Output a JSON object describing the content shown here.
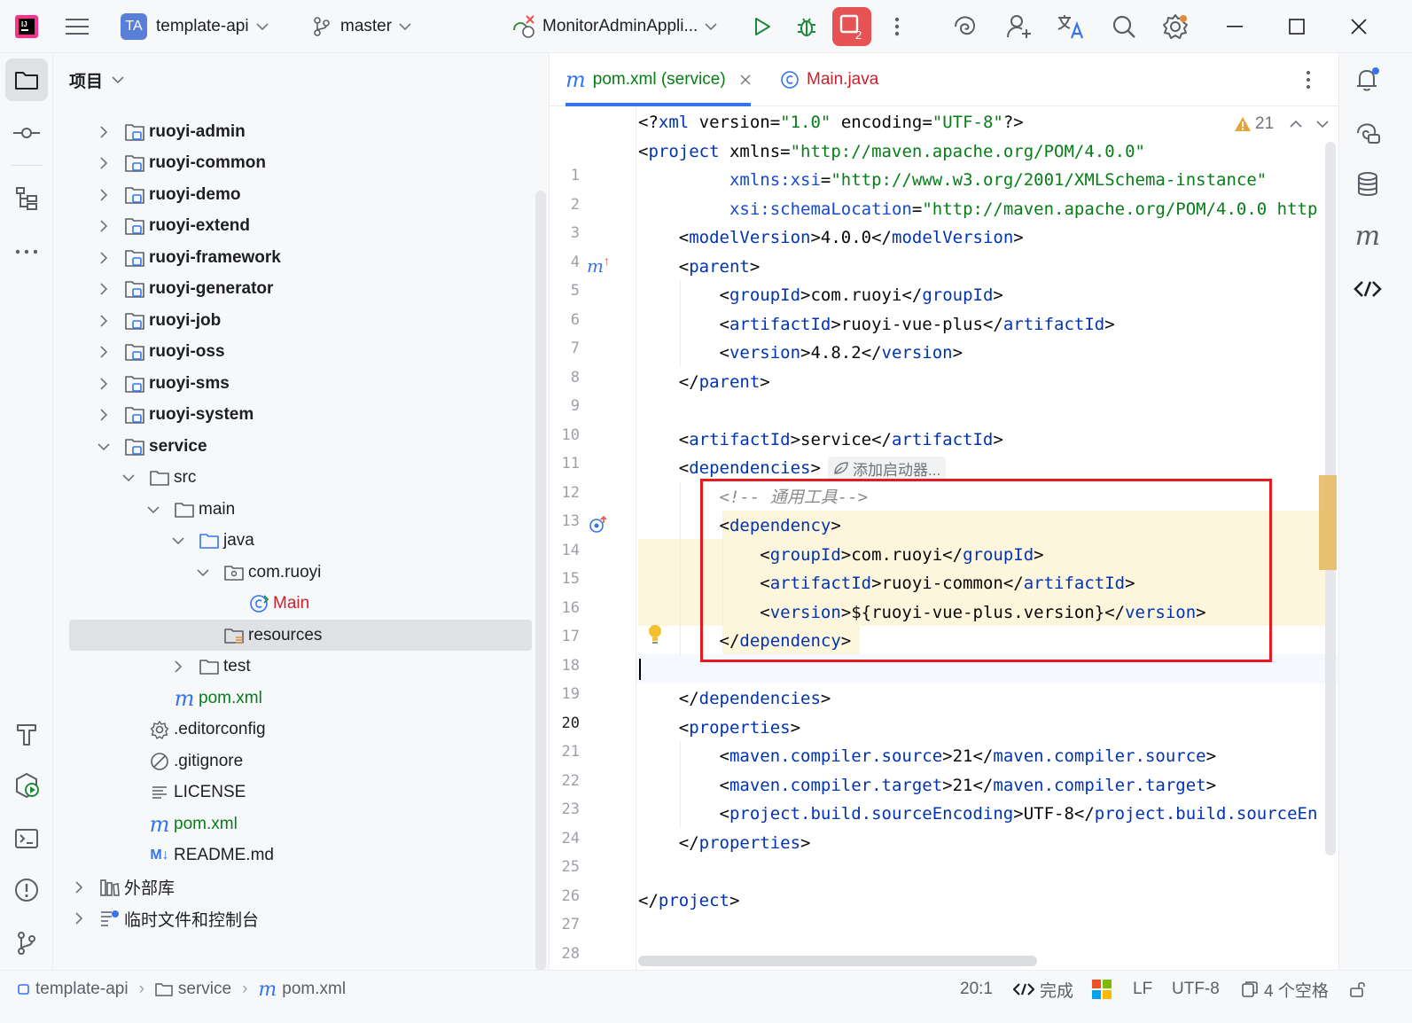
{
  "titlebar": {
    "project_badge": "TA",
    "project_name": "template-api",
    "branch": "master",
    "run_config": "MonitorAdminAppli...",
    "run_badge_count": "2",
    "icons": [
      "app-logo-icon",
      "hamburger-menu-icon",
      "branch-icon",
      "run-config-icon",
      "run-icon",
      "debug-icon",
      "more-icon",
      "ai-assistant-icon",
      "add-user-icon",
      "translate-icon",
      "search-icon",
      "settings-icon",
      "minimize-icon",
      "maximize-icon",
      "close-icon"
    ]
  },
  "project_panel": {
    "title": "项目",
    "tree": [
      {
        "label": "ruoyi-admin",
        "depth": 1,
        "kind": "module",
        "expanded": false
      },
      {
        "label": "ruoyi-common",
        "depth": 1,
        "kind": "module",
        "expanded": false
      },
      {
        "label": "ruoyi-demo",
        "depth": 1,
        "kind": "module",
        "expanded": false
      },
      {
        "label": "ruoyi-extend",
        "depth": 1,
        "kind": "module",
        "expanded": false
      },
      {
        "label": "ruoyi-framework",
        "depth": 1,
        "kind": "module",
        "expanded": false
      },
      {
        "label": "ruoyi-generator",
        "depth": 1,
        "kind": "module",
        "expanded": false
      },
      {
        "label": "ruoyi-job",
        "depth": 1,
        "kind": "module",
        "expanded": false
      },
      {
        "label": "ruoyi-oss",
        "depth": 1,
        "kind": "module",
        "expanded": false
      },
      {
        "label": "ruoyi-sms",
        "depth": 1,
        "kind": "module",
        "expanded": false
      },
      {
        "label": "ruoyi-system",
        "depth": 1,
        "kind": "module",
        "expanded": false
      },
      {
        "label": "service",
        "depth": 1,
        "kind": "module",
        "expanded": true
      },
      {
        "label": "src",
        "depth": 2,
        "kind": "folder",
        "expanded": true
      },
      {
        "label": "main",
        "depth": 3,
        "kind": "folder",
        "expanded": true
      },
      {
        "label": "java",
        "depth": 4,
        "kind": "source-folder",
        "expanded": true
      },
      {
        "label": "com.ruoyi",
        "depth": 5,
        "kind": "package",
        "expanded": true
      },
      {
        "label": "Main",
        "depth": 6,
        "kind": "class"
      },
      {
        "label": "resources",
        "depth": 5,
        "kind": "resources-folder",
        "selected": true
      },
      {
        "label": "test",
        "depth": 4,
        "kind": "folder",
        "expanded": false
      },
      {
        "label": "pom.xml",
        "depth": 3,
        "kind": "maven"
      },
      {
        "label": ".editorconfig",
        "depth": 2,
        "kind": "config"
      },
      {
        "label": ".gitignore",
        "depth": 2,
        "kind": "ignore"
      },
      {
        "label": "LICENSE",
        "depth": 2,
        "kind": "text"
      },
      {
        "label": "pom.xml",
        "depth": 2,
        "kind": "maven"
      },
      {
        "label": "README.md",
        "depth": 2,
        "kind": "markdown"
      },
      {
        "label": "外部库",
        "depth": 0,
        "kind": "library",
        "expanded": false
      },
      {
        "label": "临时文件和控制台",
        "depth": 0,
        "kind": "scratch",
        "expanded": false
      }
    ]
  },
  "editor": {
    "tabs": [
      {
        "label": "pom.xml (service)",
        "active": true,
        "icon": "maven-icon"
      },
      {
        "label": "Main.java",
        "active": false,
        "icon": "class-icon"
      }
    ],
    "warnings_count": "21",
    "inlay_hint": "添加启动器...",
    "current_line": 20,
    "lines": [
      "<?xml version=\"1.0\" encoding=\"UTF-8\"?>",
      "<project xmlns=\"http://maven.apache.org/POM/4.0.0\"",
      "         xmlns:xsi=\"http://www.w3.org/2001/XMLSchema-instance\"",
      "         xsi:schemaLocation=\"http://maven.apache.org/POM/4.0.0 http",
      "    <modelVersion>4.0.0</modelVersion>",
      "    <parent>",
      "        <groupId>com.ruoyi</groupId>",
      "        <artifactId>ruoyi-vue-plus</artifactId>",
      "        <version>4.8.2</version>",
      "    </parent>",
      "",
      "    <artifactId>service</artifactId>",
      "    <dependencies>",
      "        <!-- 通用工具-->",
      "        <dependency>",
      "            <groupId>com.ruoyi</groupId>",
      "            <artifactId>ruoyi-common</artifactId>",
      "            <version>${ruoyi-vue-plus.version}</version>",
      "        </dependency>",
      "",
      "    </dependencies>",
      "    <properties>",
      "        <maven.compiler.source>21</maven.compiler.source>",
      "        <maven.compiler.target>21</maven.compiler.target>",
      "        <project.build.sourceEncoding>UTF-8</project.build.sourceEn",
      "    </properties>",
      "",
      "</project>",
      ""
    ]
  },
  "right_strip": {
    "icons": [
      "notifications-icon",
      "ai-chat-icon",
      "database-icon",
      "maven-tool-icon",
      "endpoints-icon"
    ]
  },
  "left_strip": {
    "icons": [
      "project-icon",
      "commit-icon",
      "structure-icon",
      "more-tools-icon",
      "build-icon",
      "services-icon",
      "terminal-icon",
      "problems-icon",
      "git-icon"
    ]
  },
  "statusbar": {
    "breadcrumb": [
      "template-api",
      "service",
      "pom.xml"
    ],
    "position": "20:1",
    "status": "完成",
    "line_ending": "LF",
    "encoding": "UTF-8",
    "indent": "4 个空格"
  }
}
